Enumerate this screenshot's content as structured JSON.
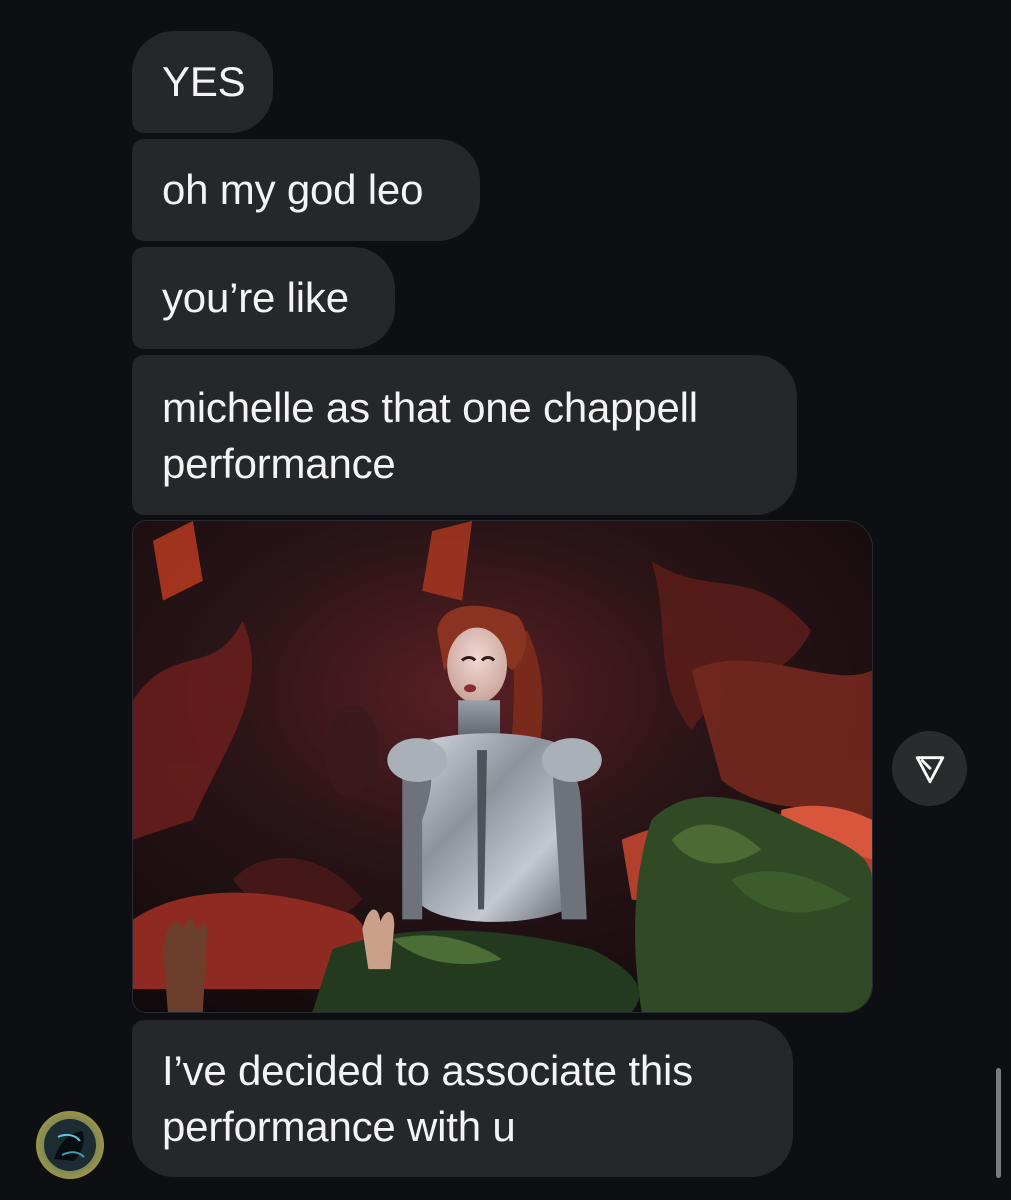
{
  "messages": [
    {
      "text_lines": [
        "YES"
      ]
    },
    {
      "text_lines": [
        "oh my god leo"
      ]
    },
    {
      "text_lines": [
        "you’re like"
      ]
    },
    {
      "text_lines": [
        "michelle as that one chappell",
        "performance"
      ]
    },
    {
      "text_lines": [
        "I’ve decided to associate this",
        "performance with u"
      ]
    }
  ],
  "photo_message": {
    "icon": "photo-image"
  },
  "share_button": {
    "icon": "share-icon"
  },
  "sender_avatar": {
    "icon": "avatar-image"
  },
  "colors": {
    "background": "#0d0f12",
    "bubble": "#26272b",
    "text": "#f4f4f6",
    "share_button": "#2a2b2f",
    "scrollbar": "#7b7c80"
  }
}
